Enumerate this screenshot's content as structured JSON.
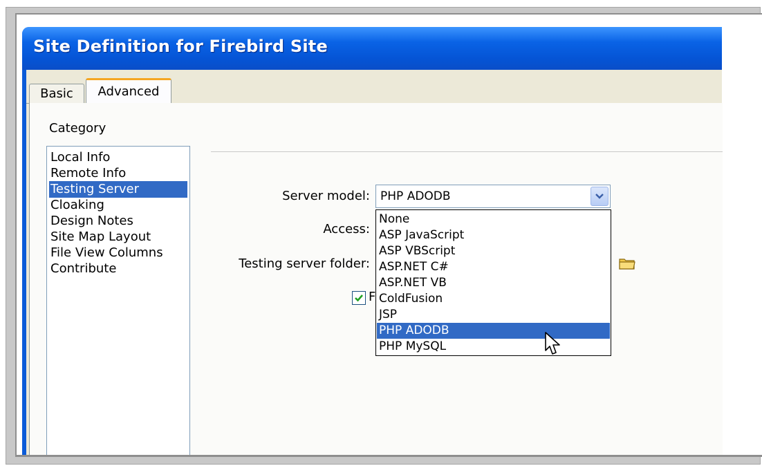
{
  "dialog": {
    "title": "Site Definition for Firebird Site"
  },
  "tabs": [
    {
      "label": "Basic",
      "active": false
    },
    {
      "label": "Advanced",
      "active": true
    }
  ],
  "category": {
    "label": "Category",
    "items": [
      {
        "label": "Local Info",
        "selected": false
      },
      {
        "label": "Remote Info",
        "selected": false
      },
      {
        "label": "Testing Server",
        "selected": true
      },
      {
        "label": "Cloaking",
        "selected": false
      },
      {
        "label": "Design Notes",
        "selected": false
      },
      {
        "label": "Site Map Layout",
        "selected": false
      },
      {
        "label": "File View Columns",
        "selected": false
      },
      {
        "label": "Contribute",
        "selected": false
      }
    ]
  },
  "form": {
    "server_model_label": "Server model:",
    "server_model_value": "PHP ADODB",
    "access_label": "Access:",
    "testing_folder_label": "Testing server folder:",
    "checkbox_checked": true,
    "checkbox_label_visible": "F"
  },
  "dropdown": {
    "options": [
      {
        "label": "None",
        "highlighted": false
      },
      {
        "label": "ASP JavaScript",
        "highlighted": false
      },
      {
        "label": "ASP VBScript",
        "highlighted": false
      },
      {
        "label": "ASP.NET C#",
        "highlighted": false
      },
      {
        "label": "ASP.NET VB",
        "highlighted": false
      },
      {
        "label": "ColdFusion",
        "highlighted": false
      },
      {
        "label": "JSP",
        "highlighted": false
      },
      {
        "label": "PHP ADODB",
        "highlighted": true
      },
      {
        "label": "PHP MySQL",
        "highlighted": false
      }
    ]
  },
  "colors": {
    "titlebar": "#0a63e6",
    "selection": "#316ac5",
    "dialog_bg": "#ece9d8",
    "tab_accent": "#f5a623"
  }
}
